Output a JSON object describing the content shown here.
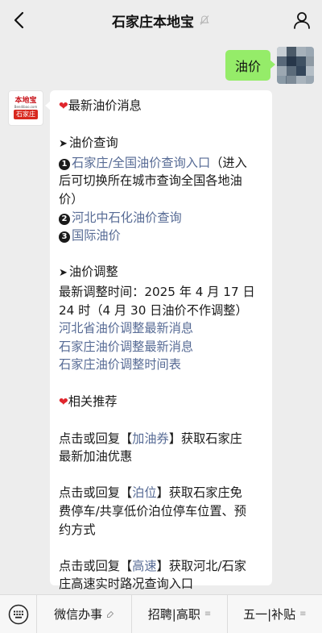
{
  "header": {
    "title": "石家庄本地宝",
    "back_icon": "chevron-left-icon",
    "user_icon": "user-icon"
  },
  "outgoing": {
    "text": "油价"
  },
  "bot_avatar": {
    "logo_text": "本地宝",
    "logo_url": "Bendibao.com",
    "city_tag": "石家庄"
  },
  "message": {
    "title": "最新油价消息",
    "query_heading": "油价查询",
    "query_items": [
      {
        "num": "1",
        "link": "石家庄/全国油价查询入口",
        "text_line1": "（进入",
        "text_line2": "后可切换所在城市查询全国各地油",
        "text_line3": "价）"
      },
      {
        "num": "2",
        "link": "河北中石化油价查询"
      },
      {
        "num": "3",
        "link": "国际油价"
      }
    ],
    "adjust_heading": "油价调整",
    "adjust_time_line1": "最新调整时间：2025 年 4 月 17 日",
    "adjust_time_line2": "24 时（4 月 30 日油价不作调整）",
    "adjust_links": [
      "河北省油价调整最新消息",
      "石家庄油价调整最新消息",
      "石家庄油价调整时间表"
    ],
    "related_heading": "相关推荐",
    "recommend": [
      {
        "pre": "点击或回复【",
        "kw": "加油券",
        "post": "】获取石家庄",
        "line2": "最新加油优惠"
      },
      {
        "pre": "点击或回复【",
        "kw": "泊位",
        "post": "】获取石家庄免",
        "line2": "费停车/共享低价泊位停车位置、预",
        "line3": "约方式"
      },
      {
        "pre": "点击或回复【",
        "kw": "高速",
        "post": "】获取河北/石家",
        "line2": "庄高速实时路况查询入口"
      }
    ]
  },
  "bottom_menu": {
    "keyboard_icon": "keyboard-icon",
    "items": [
      "微信办事",
      "招聘|高职",
      "五一|补贴"
    ]
  },
  "colors": {
    "link": "#576b95",
    "bubble_out": "#95ec69",
    "heart": "#e0262d"
  }
}
